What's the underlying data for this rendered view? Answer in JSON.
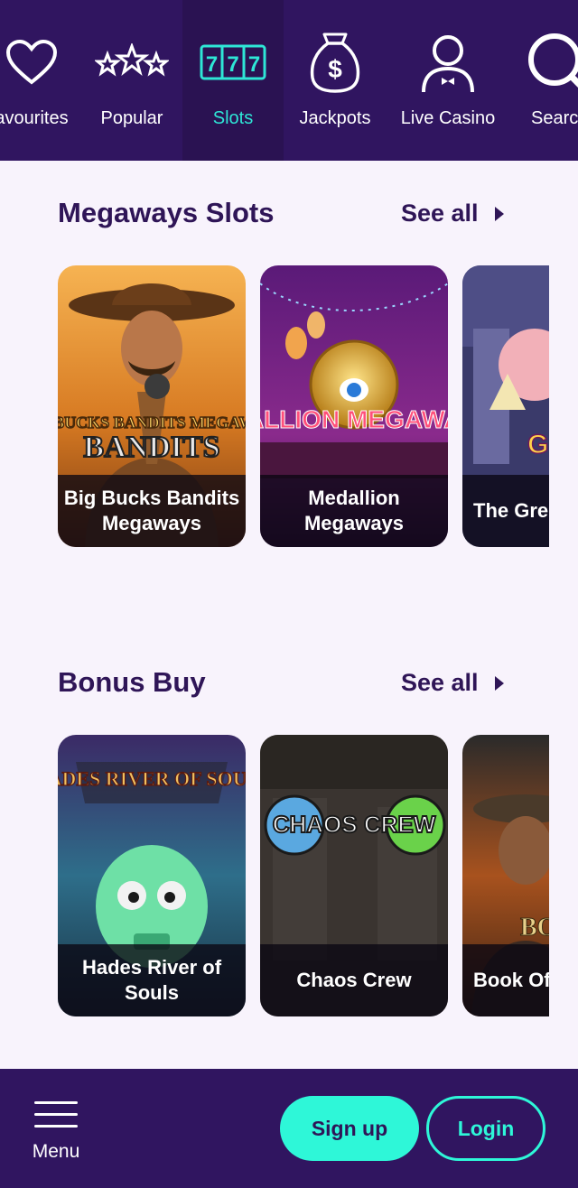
{
  "nav": {
    "items": [
      {
        "label": "avourites",
        "icon": "heart-icon"
      },
      {
        "label": "Popular",
        "icon": "stars-icon"
      },
      {
        "label": "Slots",
        "icon": "slot-777-icon",
        "active": true
      },
      {
        "label": "Jackpots",
        "icon": "money-bag-icon"
      },
      {
        "label": "Live Casino",
        "icon": "dealer-icon"
      },
      {
        "label": "Searc",
        "icon": "search-icon"
      }
    ]
  },
  "sections": [
    {
      "title": "Megaways Slots",
      "see_all": "See all",
      "games": [
        {
          "title": "Big Bucks Bandits Megaways",
          "art_text": "BIG BUCKS BANDITS MEGAWAYS"
        },
        {
          "title": "Medallion Megaways",
          "art_text": "MEDALLION MEGAWAYS™"
        },
        {
          "title": "The Gre Mega",
          "art_text": "GR PIG"
        }
      ]
    },
    {
      "title": "Bonus Buy",
      "see_all": "See all",
      "games": [
        {
          "title": "Hades River of Souls",
          "art_text": "HADES RIVER OF SOULS"
        },
        {
          "title": "Chaos Crew",
          "art_text": "CHAOS CREW"
        },
        {
          "title": "Book Of",
          "art_text": "BO"
        }
      ]
    }
  ],
  "bottom": {
    "menu_label": "Menu",
    "signup_label": "Sign up",
    "login_label": "Login"
  },
  "colors": {
    "nav_bg": "#301560",
    "accent": "#2ef7d8",
    "heading": "#2f1557",
    "page_bg": "#f8f3fc"
  }
}
